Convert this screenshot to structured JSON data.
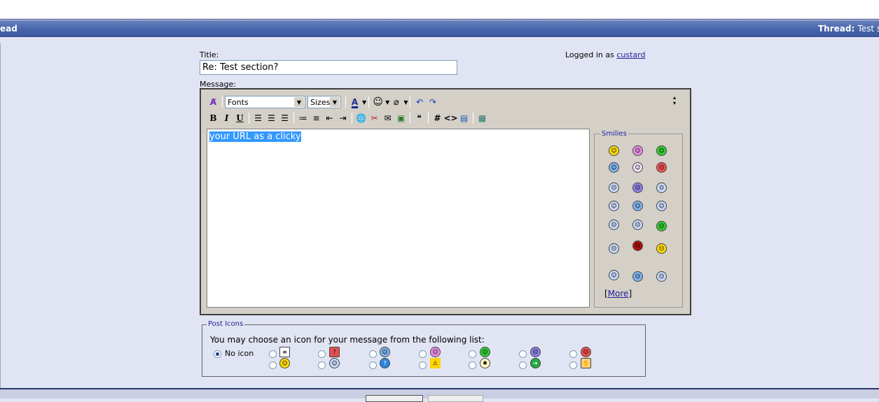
{
  "header": {
    "left_text": "ead",
    "right_label": "Thread:",
    "right_value": "Test s"
  },
  "form": {
    "title_label": "Title:",
    "title_value": "Re: Test section?",
    "message_label": "Message:",
    "logged_in_prefix": "Logged in as",
    "username": "custard"
  },
  "toolbar": {
    "font_select": "Fonts",
    "size_select": "Sizes",
    "bold": "B",
    "italic": "I",
    "underline": "U",
    "hash": "#",
    "code": "<>"
  },
  "editor": {
    "content_selected": "your URL as a clicky"
  },
  "smilies": {
    "legend": "Smilies",
    "more_open": "[",
    "more_label": "More",
    "more_close": "]"
  },
  "post_icons": {
    "legend": "Post Icons",
    "description": "You may choose an icon for your message from the following list:",
    "no_icon_label": "No icon",
    "selected": "No icon"
  },
  "colors": {
    "header_bar": "#4563a8",
    "page_bg": "#e1e4f2",
    "link": "#22229c",
    "selection": "#3399ff"
  }
}
